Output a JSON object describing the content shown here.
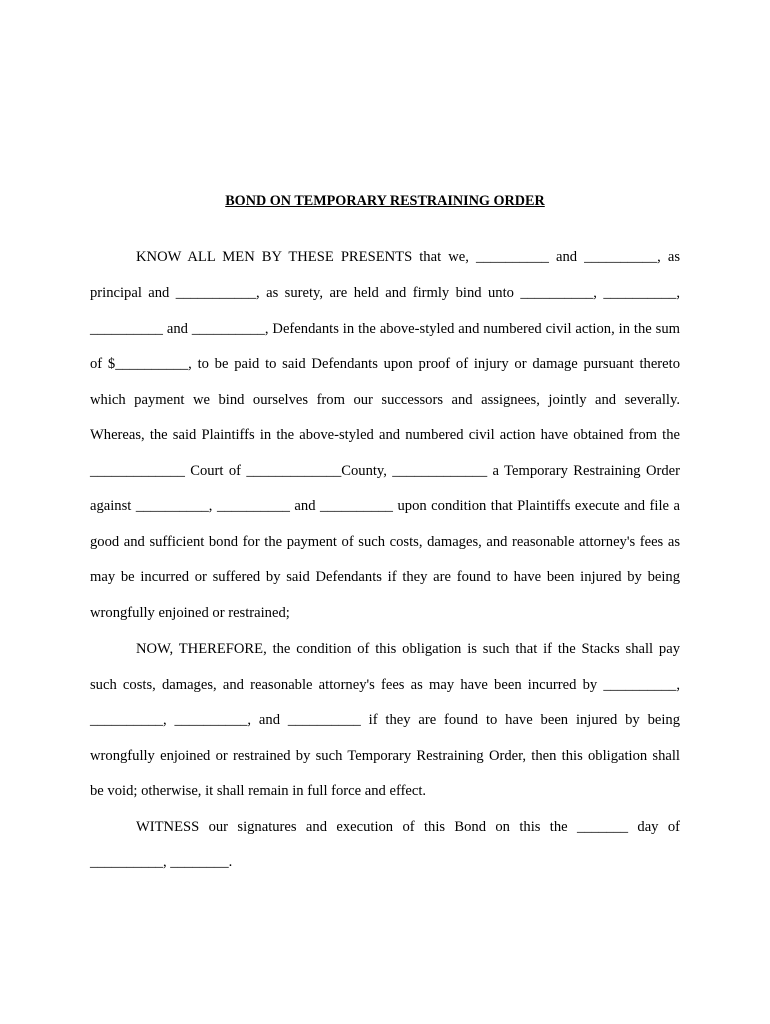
{
  "document": {
    "title": "BOND ON TEMPORARY RESTRAINING ORDER",
    "lines": [
      "KNOW ALL MEN BY THESE PRESENTS that we, __________ and __________, as",
      "principal and ___________, as surety, are held and firmly bind unto __________, __________,",
      "__________ and __________, Defendants in the above-styled and numbered civil action, in the sum",
      "of $__________, to be paid to said Defendants upon proof of injury or damage pursuant thereto",
      "which payment we bind ourselves from our successors and assignees, jointly and severally.",
      "Whereas, the said Plaintiffs in the above-styled and numbered civil action have obtained from the",
      "_____________ Court of _____________County, _____________ a Temporary Restraining Order",
      "against __________, __________ and __________ upon condition that Plaintiffs execute and file a",
      "good and sufficient bond for the payment of such costs, damages, and reasonable attorney's fees as",
      "may be incurred or suffered by said Defendants if they are found to have been injured by being",
      "wrongfully enjoined or restrained;",
      "NOW, THEREFORE, the condition of this obligation is such that if the Stacks shall pay",
      "such costs, damages, and reasonable attorney's fees as may have been incurred by __________,",
      "__________, __________, and __________ if they are found to have been injured by being",
      "wrongfully enjoined or restrained by such Temporary Restraining Order, then this obligation shall",
      "be void; otherwise, it shall remain in full force and effect.",
      "WITNESS our signatures and execution of this Bond on this the _______ day of",
      "__________, ________."
    ]
  }
}
